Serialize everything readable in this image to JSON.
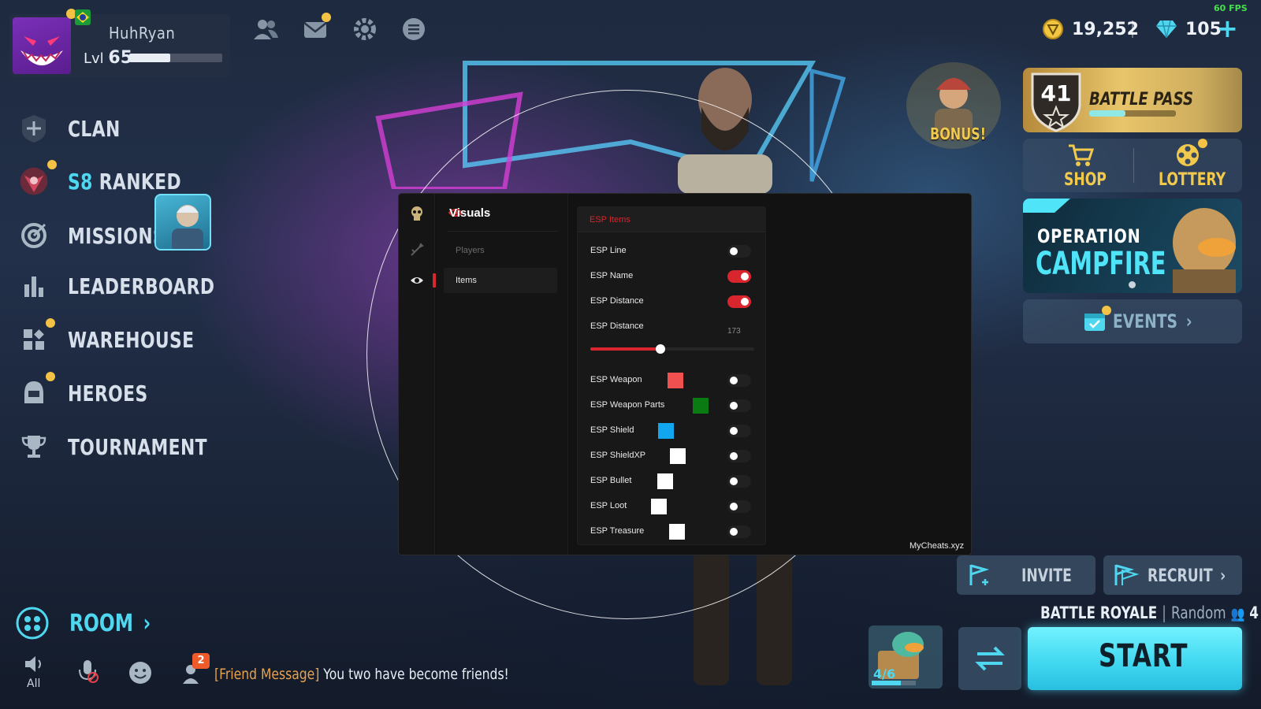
{
  "hud": {
    "fps": "60 FPS"
  },
  "profile": {
    "name": "HuhRyan",
    "level_prefix": "Lvl",
    "level": "65",
    "xp_progress": 0.44
  },
  "currency": {
    "coins": "19,252",
    "gems": "105",
    "add_symbol": "+"
  },
  "menu": {
    "items": [
      {
        "label": "CLAN",
        "icon": "plus-shield-icon"
      },
      {
        "label_prefix": "S8",
        "label": " RANKED",
        "icon": "ranked-emblem-icon"
      },
      {
        "label": "MISSIONS",
        "icon": "target-icon"
      },
      {
        "label": "LEADERBOARD",
        "icon": "bar-chart-icon"
      },
      {
        "label": "WAREHOUSE",
        "icon": "grid-icon"
      },
      {
        "label": "HEROES",
        "icon": "helmet-icon"
      },
      {
        "label": "TOURNAMENT",
        "icon": "trophy-icon"
      }
    ]
  },
  "room": {
    "label": "ROOM",
    "chevron": "›"
  },
  "bottom": {
    "volume_label": "All",
    "friend_badge": "2",
    "chat_prefix": "[Friend Message]",
    "chat_message": " You two have become friends!"
  },
  "right": {
    "bonus_label": "BONUS!",
    "battle_pass": {
      "tier": "41",
      "label": "BATTLE PASS",
      "progress": 0.42
    },
    "shop_label": "SHOP",
    "lottery_label": "LOTTERY",
    "operation": {
      "line1": "OPERATION",
      "line2": "CAMPFIRE"
    },
    "events_label": "EVENTS",
    "events_chevron": "›",
    "invite_label": "INVITE",
    "recruit_label": "RECRUIT",
    "recruit_chevron": "›",
    "mode": {
      "name": "BATTLE ROYALE",
      "type": "Random",
      "players": "4"
    },
    "crate_count": "4/6",
    "crate_progress": 0.66,
    "start_label": "START"
  },
  "cheat_menu": {
    "section_title": "Visuals",
    "nav_items": [
      "Players",
      "Items"
    ],
    "active_nav": "Items",
    "panel_title": "ESP Items",
    "rows": {
      "esp_line": {
        "label": "ESP Line",
        "on": false
      },
      "esp_name": {
        "label": "ESP Name",
        "on": true
      },
      "esp_distance_toggle": {
        "label": "ESP Distance",
        "on": true
      },
      "esp_distance_slider": {
        "label": "ESP Distance",
        "value": "173",
        "fraction": 0.43
      },
      "esp_weapon": {
        "label": "ESP Weapon",
        "color": "#f0504f",
        "on": false
      },
      "esp_weapon_parts": {
        "label": "ESP Weapon Parts",
        "color": "#0a7a12",
        "on": false
      },
      "esp_shield": {
        "label": "ESP Shield",
        "color": "#12a6ee",
        "on": false
      },
      "esp_shieldxp": {
        "label": "ESP ShieldXP",
        "color": "#ffffff",
        "on": false
      },
      "esp_bullet": {
        "label": "ESP Bullet",
        "color": "#ffffff",
        "on": false
      },
      "esp_loot": {
        "label": "ESP Loot",
        "color": "#ffffff",
        "on": false
      },
      "esp_treasure": {
        "label": "ESP Treasure",
        "color": "#ffffff",
        "on": false
      }
    },
    "watermark": "MyCheats.xyz"
  },
  "colors": {
    "accent_cyan": "#4fd7f0",
    "gold": "#f1c94c",
    "cheat_red": "#d9252d"
  }
}
